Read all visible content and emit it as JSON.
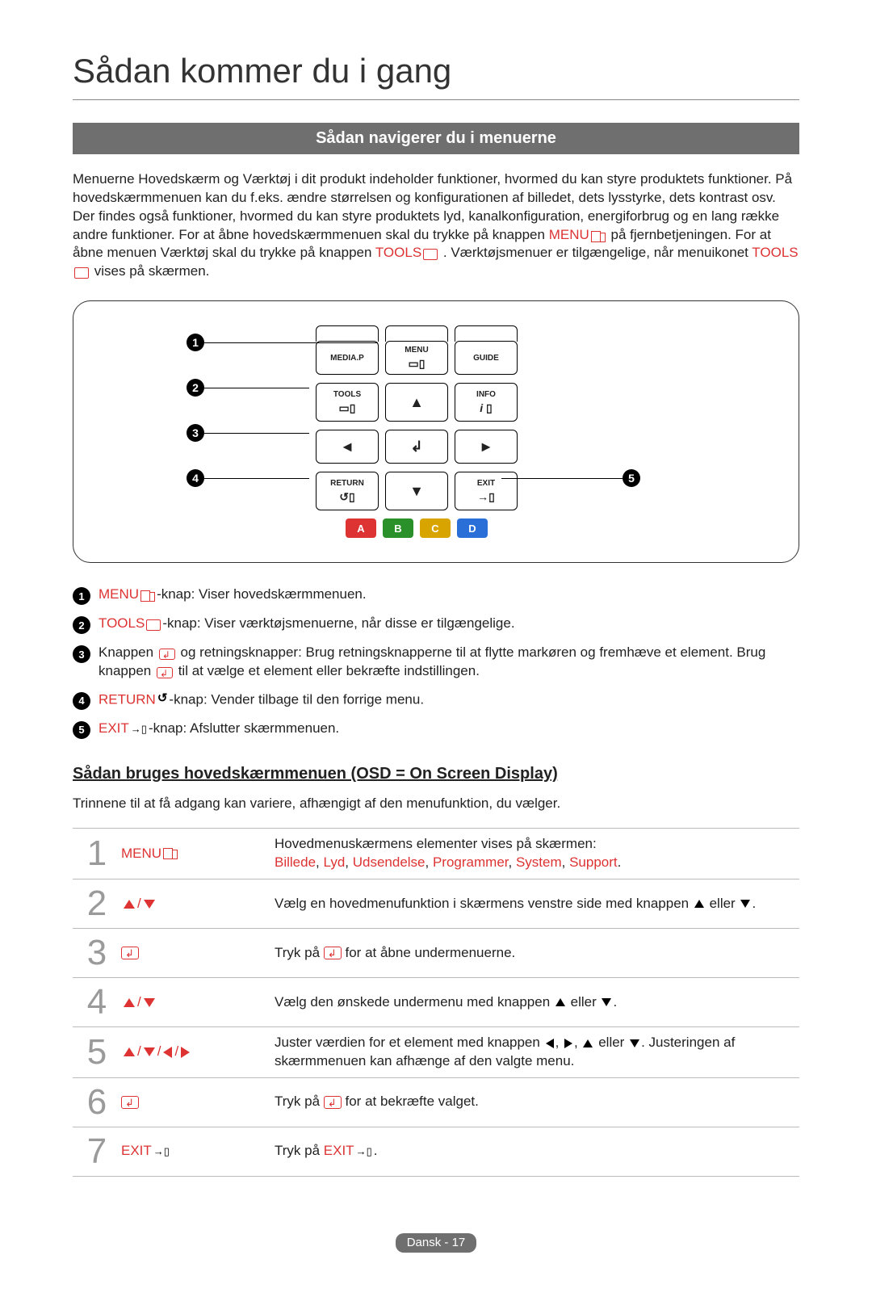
{
  "page_title": "Sådan kommer du i gang",
  "section_bar": "Sådan navigerer du i menuerne",
  "intro": {
    "part1": "Menuerne Hovedskærm og Værktøj i dit produkt indeholder funktioner, hvormed du kan styre produktets funktioner. På hovedskærmmenuen kan du f.eks. ændre størrelsen og konfigurationen af billedet, dets lysstyrke, dets kontrast osv. Der findes også funktioner, hvormed du kan styre produktets lyd, kanalkonfiguration, energiforbrug og en lang række andre funktioner. For at åbne hovedskærmmenuen skal du trykke på knappen ",
    "menu_label": "MENU",
    "part2": " på fjernbetjeningen. For at åbne menuen Værktøj skal du trykke på knappen ",
    "tools_label": "TOOLS",
    "part3": ". Værktøjsmenuer er tilgængelige, når menuikonet ",
    "tools_label2": "TOOLS",
    "part4": " vises på skærmen."
  },
  "remote": {
    "buttons": {
      "mediap": "MEDIA.P",
      "menu": "MENU",
      "guide": "GUIDE",
      "tools": "TOOLS",
      "info": "INFO",
      "return": "RETURN",
      "exit": "EXIT",
      "up": "▲",
      "down": "▼",
      "left": "◄",
      "right": "►",
      "enter": "↲"
    },
    "colors": {
      "a": "A",
      "b": "B",
      "c": "C",
      "d": "D"
    },
    "callouts": [
      "1",
      "2",
      "3",
      "4",
      "5"
    ]
  },
  "desc": [
    {
      "num": "1",
      "lead": "MENU",
      "text": "-knap: Viser hovedskærmmenuen."
    },
    {
      "num": "2",
      "lead": "TOOLS",
      "text": "-knap: Viser værktøjsmenuerne, når disse er tilgængelige."
    },
    {
      "num": "3",
      "lead": "",
      "text_a": "Knappen ",
      "text_b": " og retningsknapper: Brug retningsknapperne til at flytte markøren og fremhæve et element. Brug knappen ",
      "text_c": " til at vælge et element eller bekræfte indstillingen."
    },
    {
      "num": "4",
      "lead": "RETURN",
      "text": "-knap: Vender tilbage til den forrige menu."
    },
    {
      "num": "5",
      "lead": "EXIT",
      "text": "-knap: Afslutter skærmmenuen."
    }
  ],
  "sub_heading": "Sådan bruges hovedskærmmenuen (OSD = On Screen Display)",
  "sub_intro": "Trinnene til at få adgang kan variere, afhængigt af den menufunktion, du vælger.",
  "steps": [
    {
      "num": "1",
      "key": "MENU",
      "desc_a": "Hovedmenuskærmens elementer vises på skærmen:",
      "desc_b_items": [
        "Billede",
        "Lyd",
        "Udsendelse",
        "Programmer",
        "System",
        "Support"
      ]
    },
    {
      "num": "2",
      "key_type": "ud",
      "desc": "Vælg en hovedmenufunktion i skærmens venstre side med knappen ▲ eller ▼."
    },
    {
      "num": "3",
      "key_type": "enter",
      "desc_a": "Tryk på ",
      "desc_b": " for at åbne undermenuerne."
    },
    {
      "num": "4",
      "key_type": "ud",
      "desc": "Vælg den ønskede undermenu med knappen ▲ eller ▼."
    },
    {
      "num": "5",
      "key_type": "udlr",
      "desc": "Juster værdien for et element med knappen ◄, ►, ▲ eller ▼. Justeringen af skærmmenuen kan afhænge af den valgte menu."
    },
    {
      "num": "6",
      "key_type": "enter",
      "desc_a": "Tryk på ",
      "desc_b": " for at bekræfte valget."
    },
    {
      "num": "7",
      "key": "EXIT",
      "desc_a": "Tryk på ",
      "desc_lead": "EXIT",
      "desc_b": "."
    }
  ],
  "footer": {
    "lang": "Dansk",
    "sep": " - ",
    "page": "17"
  }
}
